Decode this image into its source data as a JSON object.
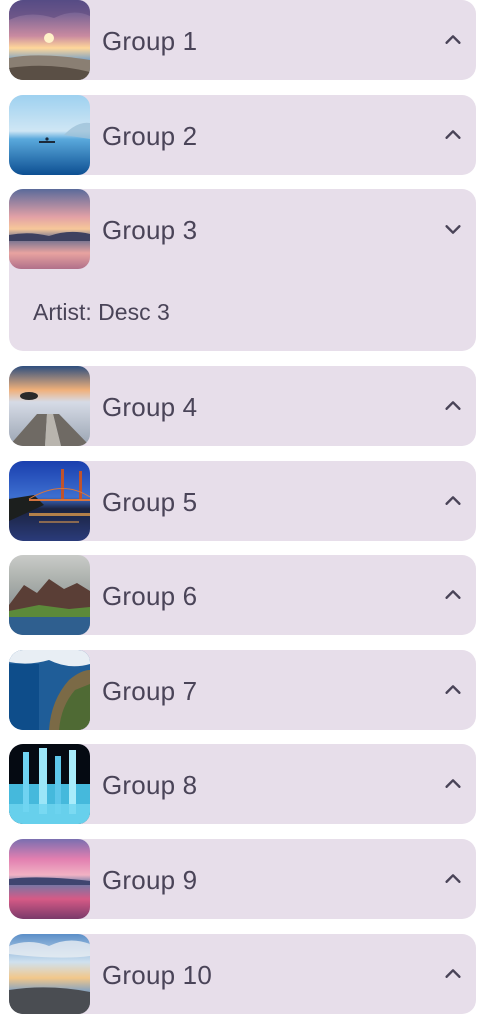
{
  "groups": [
    {
      "title": "Group 1",
      "expanded": false,
      "description": null,
      "chevron": "chevron-up-icon"
    },
    {
      "title": "Group 2",
      "expanded": false,
      "description": null,
      "chevron": "chevron-up-icon"
    },
    {
      "title": "Group 3",
      "expanded": true,
      "description": "Artist: Desc 3",
      "chevron": "chevron-down-icon"
    },
    {
      "title": "Group 4",
      "expanded": false,
      "description": null,
      "chevron": "chevron-up-icon"
    },
    {
      "title": "Group 5",
      "expanded": false,
      "description": null,
      "chevron": "chevron-up-icon"
    },
    {
      "title": "Group 6",
      "expanded": false,
      "description": null,
      "chevron": "chevron-up-icon"
    },
    {
      "title": "Group 7",
      "expanded": false,
      "description": null,
      "chevron": "chevron-up-icon"
    },
    {
      "title": "Group 8",
      "expanded": false,
      "description": null,
      "chevron": "chevron-up-icon"
    },
    {
      "title": "Group 9",
      "expanded": false,
      "description": null,
      "chevron": "chevron-up-icon"
    },
    {
      "title": "Group 10",
      "expanded": false,
      "description": null,
      "chevron": "chevron-up-icon"
    }
  ],
  "colors": {
    "card_background": "#e7deea",
    "text": "#4a4458"
  }
}
